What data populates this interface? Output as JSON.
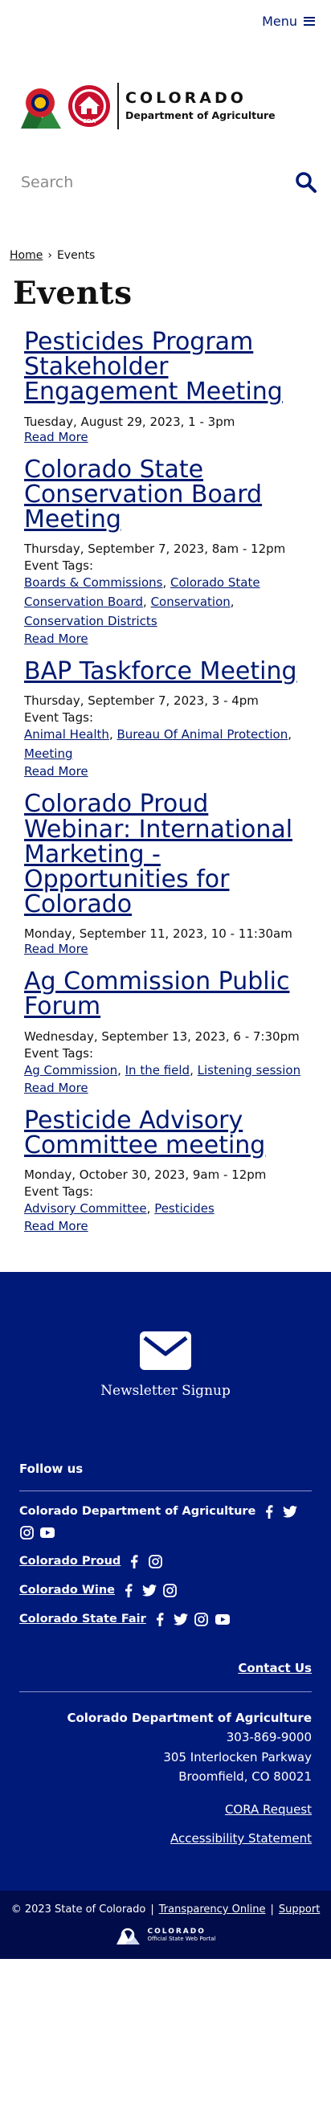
{
  "header": {
    "menu_label": "Menu",
    "logo_title": "COLORADO",
    "logo_subtitle": "Department of Agriculture",
    "logo_badge": "CDA",
    "search_placeholder": "Search"
  },
  "breadcrumb": {
    "home": "Home",
    "separator": "›",
    "current": "Events"
  },
  "page_title": "Events",
  "events": [
    {
      "title": "Pesticides Program Stakeholder Engagement Meeting",
      "date": "Tuesday, August 29, 2023, 1 - 3pm",
      "read_more": "Read More"
    },
    {
      "title": "Colorado State Conservation Board Meeting",
      "date": "Thursday, September 7, 2023, 8am - 12pm",
      "tags_label": "Event Tags:",
      "tags": [
        "Boards & Commissions",
        "Colorado State Conservation Board",
        "Conservation",
        "Conservation Districts"
      ],
      "read_more": "Read More"
    },
    {
      "title": "BAP Taskforce Meeting",
      "date": "Thursday, September 7, 2023, 3 - 4pm",
      "tags_label": "Event Tags:",
      "tags": [
        "Animal Health",
        "Bureau Of Animal Protection",
        "Meeting"
      ],
      "read_more": "Read More"
    },
    {
      "title": "Colorado Proud Webinar: International Marketing - Opportunities for Colorado",
      "date": "Monday, September 11, 2023, 10 - 11:30am",
      "read_more": "Read More"
    },
    {
      "title": "Ag Commission Public Forum",
      "date": "Wednesday, September 13, 2023, 6 - 7:30pm",
      "tags_label": "Event Tags:",
      "tags": [
        "Ag Commission",
        "In the field",
        "Listening session"
      ],
      "read_more": "Read More"
    },
    {
      "title": "Pesticide Advisory Committee meeting",
      "date": "Monday, October 30, 2023, 9am - 12pm",
      "tags_label": "Event Tags:",
      "tags": [
        "Advisory Committee",
        "Pesticides"
      ],
      "read_more": "Read More"
    }
  ],
  "footer": {
    "newsletter_label": "Newsletter Signup",
    "follow_heading": "Follow us",
    "social": [
      {
        "name": "Colorado Department of Agriculture",
        "icons": [
          "facebook-icon",
          "twitter-icon",
          "instagram-icon",
          "youtube-icon"
        ]
      },
      {
        "name": "Colorado Proud",
        "icons": [
          "facebook-icon",
          "instagram-icon"
        ]
      },
      {
        "name": "Colorado Wine",
        "icons": [
          "facebook-icon",
          "twitter-icon",
          "instagram-icon"
        ]
      },
      {
        "name": "Colorado State Fair",
        "icons": [
          "facebook-icon",
          "twitter-icon",
          "instagram-icon",
          "youtube-icon"
        ]
      }
    ],
    "contact_us": "Contact Us",
    "address": {
      "org": "Colorado Department of Agriculture",
      "phone": "303-869-9000",
      "street": "305 Interlocken Parkway",
      "city": "Broomfield, CO 80021"
    },
    "cora_request": "CORA Request",
    "accessibility": "Accessibility Statement",
    "copyright": "© 2023 State of Colorado",
    "transparency": "Transparency Online",
    "support": "Support",
    "portal_title": "COLORADO",
    "portal_subtitle": "Official State Web Portal"
  },
  "colors": {
    "brand_navy": "#001970",
    "footer_bg": "#001a7a",
    "bottom_bar": "#000d4a"
  }
}
